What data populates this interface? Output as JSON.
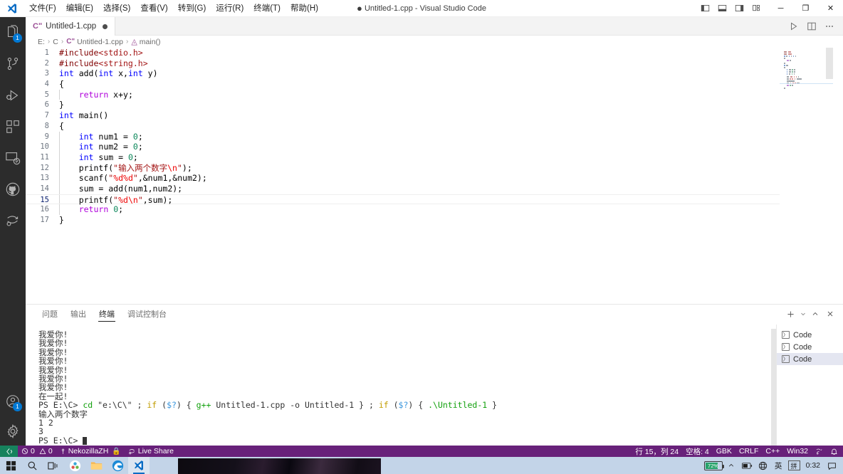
{
  "titlebar": {
    "logo_icon": "vscode-logo-icon",
    "window_title": "Untitled-1.cpp - Visual Studio Code",
    "dirty_marker": "●",
    "menus": [
      {
        "label": "文件(F)",
        "name": "menu-file"
      },
      {
        "label": "编辑(E)",
        "name": "menu-edit"
      },
      {
        "label": "选择(S)",
        "name": "menu-selection"
      },
      {
        "label": "查看(V)",
        "name": "menu-view"
      },
      {
        "label": "转到(G)",
        "name": "menu-go"
      },
      {
        "label": "运行(R)",
        "name": "menu-run"
      },
      {
        "label": "终端(T)",
        "name": "menu-terminal"
      },
      {
        "label": "帮助(H)",
        "name": "menu-help"
      }
    ],
    "layout_buttons": [
      {
        "name": "toggle-primary-sidebar-icon"
      },
      {
        "name": "toggle-panel-icon"
      },
      {
        "name": "toggle-secondary-sidebar-icon"
      },
      {
        "name": "customize-layout-icon"
      }
    ],
    "window_buttons": [
      {
        "name": "minimize-button",
        "glyph": "─"
      },
      {
        "name": "maximize-button",
        "glyph": "❐"
      },
      {
        "name": "close-button",
        "glyph": "✕"
      }
    ]
  },
  "activitybar": {
    "items": [
      {
        "name": "activity-explorer",
        "icon": "files-icon",
        "badge": "1"
      },
      {
        "name": "activity-source-control",
        "icon": "source-control-icon",
        "badge": ""
      },
      {
        "name": "activity-run-debug",
        "icon": "run-and-debug-icon",
        "badge": ""
      },
      {
        "name": "activity-extensions",
        "icon": "extensions-icon",
        "badge": ""
      },
      {
        "name": "activity-remote-explorer",
        "icon": "remote-explorer-icon",
        "badge": ""
      },
      {
        "name": "activity-github",
        "icon": "github-icon",
        "badge": ""
      },
      {
        "name": "activity-live-share",
        "icon": "live-share-icon",
        "badge": ""
      }
    ],
    "bottom_items": [
      {
        "name": "activity-accounts",
        "icon": "account-icon",
        "badge": "1"
      },
      {
        "name": "activity-settings",
        "icon": "gear-icon",
        "badge": ""
      }
    ]
  },
  "editor": {
    "tab": {
      "label": "Untitled-1.cpp",
      "icon_text": "Cʺ",
      "dirty": true
    },
    "actions": [
      {
        "name": "run-code-button",
        "icon": "play-icon"
      },
      {
        "name": "split-editor-button",
        "icon": "split-editor-icon"
      },
      {
        "name": "more-actions-button",
        "icon": "ellipsis-icon"
      }
    ],
    "breadcrumb": [
      "E:",
      "C",
      "Untitled-1.cpp",
      "main()"
    ],
    "breadcrumb_file_icon": "cpp-file-icon",
    "breadcrumb_symbol_icon": "method-symbol-icon",
    "current_line": 15,
    "lines": [
      {
        "n": "1",
        "indent": 0,
        "tokens": [
          {
            "t": "#include",
            "c": "pp"
          },
          {
            "t": "<stdio.h>",
            "c": "str"
          }
        ]
      },
      {
        "n": "2",
        "indent": 0,
        "tokens": [
          {
            "t": "#include",
            "c": "pp"
          },
          {
            "t": "<string.h>",
            "c": "str"
          }
        ]
      },
      {
        "n": "3",
        "indent": 0,
        "tokens": [
          {
            "t": "int",
            "c": "kw"
          },
          {
            "t": " add(",
            "c": "plain"
          },
          {
            "t": "int",
            "c": "kw"
          },
          {
            "t": " x,",
            "c": "plain"
          },
          {
            "t": "int",
            "c": "kw"
          },
          {
            "t": " y)",
            "c": "plain"
          }
        ]
      },
      {
        "n": "4",
        "indent": 0,
        "tokens": [
          {
            "t": "{",
            "c": "plain"
          }
        ]
      },
      {
        "n": "5",
        "indent": 1,
        "tokens": [
          {
            "t": "    ",
            "c": "plain"
          },
          {
            "t": "return",
            "c": "kw2"
          },
          {
            "t": " x+y;",
            "c": "plain"
          }
        ]
      },
      {
        "n": "6",
        "indent": 0,
        "tokens": [
          {
            "t": "}",
            "c": "plain"
          }
        ]
      },
      {
        "n": "7",
        "indent": 0,
        "tokens": [
          {
            "t": "int",
            "c": "kw"
          },
          {
            "t": " main()",
            "c": "plain"
          }
        ]
      },
      {
        "n": "8",
        "indent": 0,
        "tokens": [
          {
            "t": "{",
            "c": "plain"
          }
        ]
      },
      {
        "n": "9",
        "indent": 1,
        "tokens": [
          {
            "t": "    ",
            "c": "plain"
          },
          {
            "t": "int",
            "c": "kw"
          },
          {
            "t": " num1 = ",
            "c": "plain"
          },
          {
            "t": "0",
            "c": "num"
          },
          {
            "t": ";",
            "c": "plain"
          }
        ]
      },
      {
        "n": "10",
        "indent": 1,
        "tokens": [
          {
            "t": "    ",
            "c": "plain"
          },
          {
            "t": "int",
            "c": "kw"
          },
          {
            "t": " num2 = ",
            "c": "plain"
          },
          {
            "t": "0",
            "c": "num"
          },
          {
            "t": ";",
            "c": "plain"
          }
        ]
      },
      {
        "n": "11",
        "indent": 1,
        "tokens": [
          {
            "t": "    ",
            "c": "plain"
          },
          {
            "t": "int",
            "c": "kw"
          },
          {
            "t": " sum = ",
            "c": "plain"
          },
          {
            "t": "0",
            "c": "num"
          },
          {
            "t": ";",
            "c": "plain"
          }
        ]
      },
      {
        "n": "12",
        "indent": 1,
        "tokens": [
          {
            "t": "    printf(",
            "c": "plain"
          },
          {
            "t": "\"输入两个数字",
            "c": "str"
          },
          {
            "t": "\\n",
            "c": "esc"
          },
          {
            "t": "\"",
            "c": "str"
          },
          {
            "t": ");",
            "c": "plain"
          }
        ]
      },
      {
        "n": "13",
        "indent": 1,
        "tokens": [
          {
            "t": "    scanf(",
            "c": "plain"
          },
          {
            "t": "\"",
            "c": "str"
          },
          {
            "t": "%d%d",
            "c": "esc"
          },
          {
            "t": "\"",
            "c": "str"
          },
          {
            "t": ",&num1,&num2);",
            "c": "plain"
          }
        ]
      },
      {
        "n": "14",
        "indent": 1,
        "tokens": [
          {
            "t": "    sum = add(num1,num2);",
            "c": "plain"
          }
        ]
      },
      {
        "n": "15",
        "indent": 1,
        "tokens": [
          {
            "t": "    printf(",
            "c": "plain"
          },
          {
            "t": "\"",
            "c": "str"
          },
          {
            "t": "%d\\n",
            "c": "esc"
          },
          {
            "t": "\"",
            "c": "str"
          },
          {
            "t": ",sum);",
            "c": "plain"
          }
        ]
      },
      {
        "n": "16",
        "indent": 1,
        "tokens": [
          {
            "t": "    ",
            "c": "plain"
          },
          {
            "t": "return",
            "c": "kw2"
          },
          {
            "t": " ",
            "c": "plain"
          },
          {
            "t": "0",
            "c": "num"
          },
          {
            "t": ";",
            "c": "plain"
          }
        ]
      },
      {
        "n": "17",
        "indent": 0,
        "tokens": [
          {
            "t": "}",
            "c": "plain"
          }
        ]
      }
    ]
  },
  "panel": {
    "tabs": [
      {
        "label": "问题",
        "name": "panel-tab-problems",
        "active": false
      },
      {
        "label": "输出",
        "name": "panel-tab-output",
        "active": false
      },
      {
        "label": "终端",
        "name": "panel-tab-terminal",
        "active": true
      },
      {
        "label": "调试控制台",
        "name": "panel-tab-debug-console",
        "active": false
      }
    ],
    "actions": [
      {
        "name": "new-terminal-button",
        "icon": "plus-icon"
      },
      {
        "name": "terminal-profile-dropdown",
        "icon": "chevron-down-icon"
      },
      {
        "name": "maximize-panel-button",
        "icon": "chevron-up-icon"
      },
      {
        "name": "close-panel-button",
        "icon": "close-icon"
      }
    ],
    "terminal_lines": [
      [
        {
          "t": "我爱你!",
          "c": "t-white"
        }
      ],
      [
        {
          "t": "我爱你!",
          "c": "t-white"
        }
      ],
      [
        {
          "t": "我爱你!",
          "c": "t-white"
        }
      ],
      [
        {
          "t": "我爱你!",
          "c": "t-white"
        }
      ],
      [
        {
          "t": "我爱你!",
          "c": "t-white"
        }
      ],
      [
        {
          "t": "我爱你!",
          "c": "t-white"
        }
      ],
      [
        {
          "t": "我爱你!",
          "c": "t-white"
        }
      ],
      [
        {
          "t": "在一起!",
          "c": "t-white"
        }
      ],
      [
        {
          "t": "PS E:\\C> ",
          "c": "t-white"
        },
        {
          "t": "cd",
          "c": "t-green"
        },
        {
          "t": " ",
          "c": "t-white"
        },
        {
          "t": "\"e:\\C\\\"",
          "c": "t-white"
        },
        {
          "t": " ; ",
          "c": "t-white"
        },
        {
          "t": "if",
          "c": "t-yellow"
        },
        {
          "t": " (",
          "c": "t-white"
        },
        {
          "t": "$?",
          "c": "t-cyan"
        },
        {
          "t": ") { ",
          "c": "t-white"
        },
        {
          "t": "g++",
          "c": "t-green"
        },
        {
          "t": " Untitled-1.cpp -o Untitled-1 } ; ",
          "c": "t-white"
        },
        {
          "t": "if",
          "c": "t-yellow"
        },
        {
          "t": " (",
          "c": "t-white"
        },
        {
          "t": "$?",
          "c": "t-cyan"
        },
        {
          "t": ") { ",
          "c": "t-white"
        },
        {
          "t": ".\\Untitled-1",
          "c": "t-green"
        },
        {
          "t": " }",
          "c": "t-white"
        }
      ],
      [
        {
          "t": "输入两个数字",
          "c": "t-white"
        }
      ],
      [
        {
          "t": "1 2",
          "c": "t-white"
        }
      ],
      [
        {
          "t": "3",
          "c": "t-white"
        }
      ],
      [
        {
          "t": "PS E:\\C> ",
          "c": "t-white"
        }
      ]
    ],
    "terminal_list": [
      {
        "label": "Code",
        "selected": false,
        "icon": "terminal-icon"
      },
      {
        "label": "Code",
        "selected": false,
        "icon": "terminal-icon"
      },
      {
        "label": "Code",
        "selected": true,
        "icon": "terminal-icon"
      }
    ]
  },
  "statusbar": {
    "remote_icon": "remote-indicator-icon",
    "left": [
      {
        "name": "status-problems",
        "label": "0 ⚠ 0",
        "icon": "error-warning-icon",
        "errors": "0",
        "warnings": "0"
      },
      {
        "name": "status-source-control",
        "label": "NekozillaZH",
        "icon": "source-control-icon",
        "extra_icon": "lock-icon"
      },
      {
        "name": "status-live-share",
        "label": "Live Share",
        "icon": "live-share-icon"
      }
    ],
    "right": [
      {
        "name": "status-cursor-position",
        "label": "行 15，列 24"
      },
      {
        "name": "status-indentation",
        "label": "空格: 4"
      },
      {
        "name": "status-encoding",
        "label": "GBK"
      },
      {
        "name": "status-eol",
        "label": "CRLF"
      },
      {
        "name": "status-language-mode",
        "label": "C++"
      },
      {
        "name": "status-platform",
        "label": "Win32"
      },
      {
        "name": "status-feedback",
        "label": "",
        "icon": "tweet-feedback-icon"
      },
      {
        "name": "status-notifications",
        "label": "",
        "icon": "bell-icon"
      }
    ]
  },
  "taskbar": {
    "items": [
      {
        "name": "taskbar-start-button",
        "icon": "windows-start-icon"
      },
      {
        "name": "taskbar-search-button",
        "icon": "search-icon"
      },
      {
        "name": "taskbar-task-view-button",
        "icon": "task-view-icon"
      },
      {
        "name": "taskbar-app-qq",
        "icon": "qq-icon"
      },
      {
        "name": "taskbar-file-explorer",
        "icon": "folder-icon"
      },
      {
        "name": "taskbar-edge",
        "icon": "edge-icon"
      },
      {
        "name": "taskbar-vscode",
        "icon": "vscode-icon",
        "active": true
      }
    ],
    "tray": {
      "battery_percent": "72%",
      "battery_level": 72,
      "show_hidden_icon": "chevron-up-icon",
      "icons": [
        {
          "name": "tray-battery-icon"
        },
        {
          "name": "tray-network-icon"
        },
        {
          "name": "tray-ime-language",
          "label": "英"
        },
        {
          "name": "tray-ime-mode",
          "label": "拼"
        }
      ],
      "clock": "0:32",
      "action_center_icon": "action-center-icon"
    }
  },
  "colors": {
    "accent_purple": "#68217a",
    "remote_green": "#16825d",
    "badge_blue": "#0078d4",
    "activity_bg": "#2c2c2c",
    "taskbar_bg": "#c3d4e8"
  }
}
